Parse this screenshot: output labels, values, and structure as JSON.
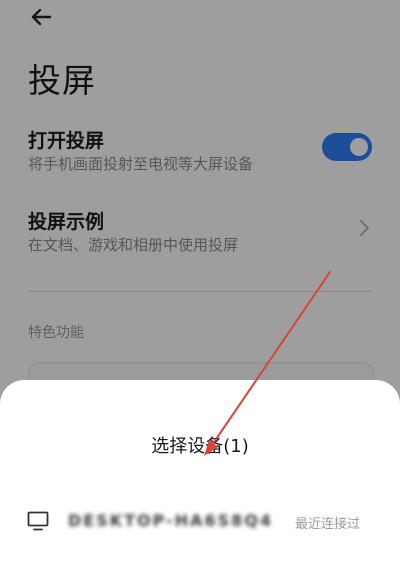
{
  "header": {
    "back_icon": "arrow-left-icon",
    "title": "投屏"
  },
  "settings": {
    "enable_cast": {
      "title": "打开投屏",
      "subtitle": "将手机画面投射至电视等大屏设备",
      "toggle_on": true,
      "toggle_color": "#2f7cf6"
    },
    "cast_examples": {
      "title": "投屏示例",
      "subtitle": "在文档、游戏和相册中使用投屏",
      "chevron_icon": "chevron-right-icon"
    },
    "features_section_label": "特色功能"
  },
  "device_sheet": {
    "title": "选择设备(1)",
    "devices": [
      {
        "icon": "monitor-icon",
        "name": "DESKTOP-HA6S8Q4",
        "status": "最近连接过"
      }
    ]
  },
  "annotation": {
    "arrow_color": "#d9443a"
  }
}
